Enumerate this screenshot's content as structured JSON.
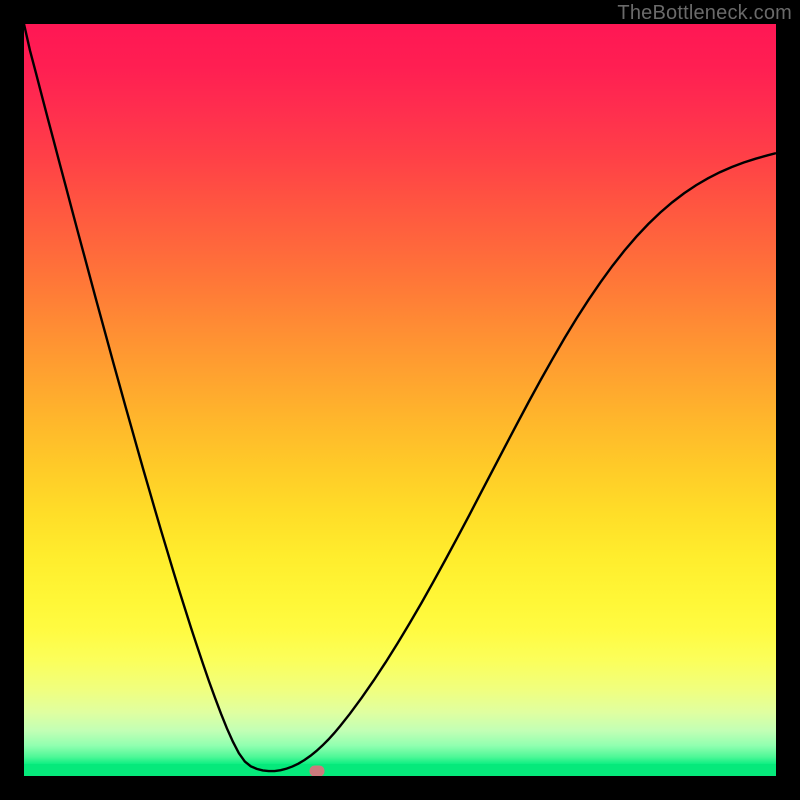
{
  "watermark": {
    "text": "TheBottleneck.com"
  },
  "chart_data": {
    "type": "line",
    "title": "",
    "xlabel": "",
    "ylabel": "",
    "xlim": [
      0,
      100
    ],
    "ylim": [
      0,
      100
    ],
    "grid": false,
    "gradient_stops": [
      {
        "pos": 0.0,
        "color": "#ff1754"
      },
      {
        "pos": 0.06,
        "color": "#ff1f52"
      },
      {
        "pos": 0.12,
        "color": "#ff2f4e"
      },
      {
        "pos": 0.18,
        "color": "#ff4047"
      },
      {
        "pos": 0.24,
        "color": "#ff5441"
      },
      {
        "pos": 0.3,
        "color": "#ff673c"
      },
      {
        "pos": 0.36,
        "color": "#ff7b37"
      },
      {
        "pos": 0.42,
        "color": "#ff9033"
      },
      {
        "pos": 0.48,
        "color": "#ffa42f"
      },
      {
        "pos": 0.54,
        "color": "#ffb82b"
      },
      {
        "pos": 0.6,
        "color": "#ffcb28"
      },
      {
        "pos": 0.66,
        "color": "#ffdd28"
      },
      {
        "pos": 0.72,
        "color": "#ffed2d"
      },
      {
        "pos": 0.78,
        "color": "#fff737"
      },
      {
        "pos": 0.82,
        "color": "#fffb42"
      },
      {
        "pos": 0.86,
        "color": "#fbff5b"
      },
      {
        "pos": 0.9,
        "color": "#f0ff7f"
      },
      {
        "pos": 0.93,
        "color": "#e0ffa0"
      },
      {
        "pos": 0.955,
        "color": "#c2ffb5"
      },
      {
        "pos": 0.975,
        "color": "#91ffb0"
      },
      {
        "pos": 0.99,
        "color": "#50f898"
      },
      {
        "pos": 1.0,
        "color": "#0fef82"
      }
    ],
    "series": [
      {
        "name": "bottleneck-curve",
        "color": "#000000",
        "width": 2.4,
        "x": [
          0.0,
          0.79,
          1.59,
          2.38,
          3.17,
          3.97,
          4.76,
          5.56,
          6.35,
          7.14,
          7.94,
          8.73,
          9.52,
          10.32,
          11.11,
          11.9,
          12.7,
          13.49,
          14.29,
          15.08,
          15.87,
          16.67,
          17.46,
          18.25,
          19.05,
          19.84,
          20.63,
          21.43,
          22.22,
          23.02,
          23.81,
          24.6,
          25.4,
          26.19,
          26.98,
          27.78,
          28.57,
          29.37,
          30.16,
          30.95,
          31.75,
          32.54,
          33.33,
          34.13,
          34.92,
          35.71,
          36.51,
          37.3,
          38.1,
          38.89,
          39.68,
          40.48,
          41.27,
          42.06,
          43.33,
          44.92,
          46.51,
          48.1,
          49.68,
          51.27,
          52.86,
          54.44,
          56.03,
          57.62,
          59.21,
          60.79,
          62.38,
          63.97,
          65.56,
          67.14,
          68.73,
          70.32,
          71.9,
          73.49,
          75.08,
          76.67,
          78.25,
          79.84,
          81.43,
          83.02,
          84.6,
          86.19,
          87.78,
          89.37,
          90.95,
          92.54,
          94.13,
          95.71,
          97.3,
          98.89,
          100.0
        ],
        "y": [
          100.0,
          96.5,
          93.47,
          90.43,
          87.41,
          84.4,
          81.39,
          78.4,
          75.41,
          72.44,
          69.48,
          66.53,
          63.59,
          60.67,
          57.77,
          54.88,
          52.01,
          49.16,
          46.33,
          43.52,
          40.74,
          37.99,
          35.26,
          32.57,
          29.91,
          27.28,
          24.7,
          22.17,
          19.68,
          17.25,
          14.89,
          12.6,
          10.4,
          8.3,
          6.34,
          4.56,
          3.04,
          1.92,
          1.29,
          0.95,
          0.74,
          0.65,
          0.66,
          0.77,
          0.98,
          1.27,
          1.66,
          2.13,
          2.69,
          3.33,
          4.05,
          4.85,
          5.72,
          6.67,
          8.27,
          10.43,
          12.72,
          15.13,
          17.65,
          20.29,
          23.02,
          25.84,
          28.74,
          31.69,
          34.69,
          37.72,
          40.77,
          43.81,
          46.83,
          49.8,
          52.71,
          55.53,
          58.26,
          60.87,
          63.34,
          65.67,
          67.84,
          69.86,
          71.71,
          73.4,
          74.92,
          76.28,
          77.49,
          78.56,
          79.48,
          80.29,
          80.98,
          81.58,
          82.09,
          82.54,
          82.82
        ]
      }
    ],
    "marker": {
      "x": 39.0,
      "y": 0.6,
      "color": "#cd7a7d"
    }
  }
}
